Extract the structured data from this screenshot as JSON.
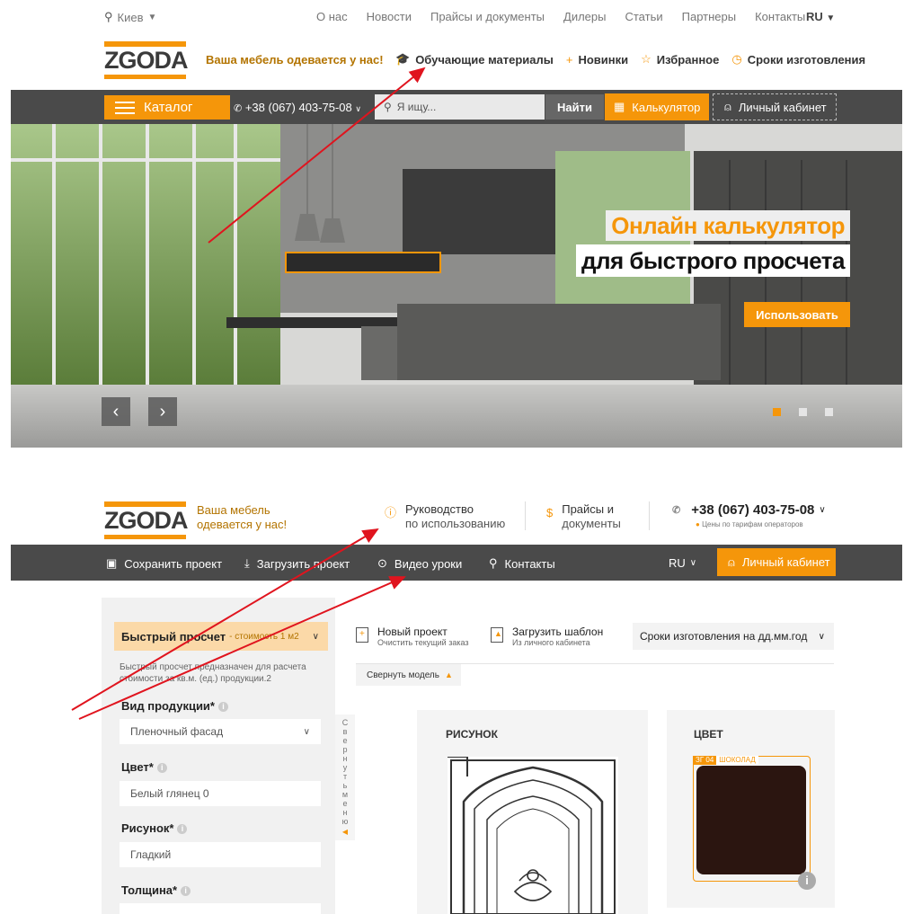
{
  "topbar": {
    "city": "Киев",
    "links": [
      "О нас",
      "Новости",
      "Прайсы и документы",
      "Дилеры",
      "Статьи",
      "Партнеры",
      "Контакты"
    ],
    "lang": "RU"
  },
  "header1": {
    "logo": "ZGODA",
    "tagline": "Ваша мебель одевается у нас!",
    "links": [
      "Обучающие материалы",
      "Новинки",
      "Избранное",
      "Сроки изготовления"
    ]
  },
  "bar1": {
    "catalog": "Каталог",
    "phone": "+38 (067) 403-75-08",
    "search_placeholder": "Я ищу...",
    "find": "Найти",
    "calculator": "Калькулятор",
    "cabinet": "Личный кабинет"
  },
  "hero": {
    "title1": "Онлайн калькулятор",
    "title2": "для быстрого просчета",
    "button": "Использовать"
  },
  "header2": {
    "logo": "ZGODA",
    "tagline_line1": "Ваша мебель",
    "tagline_line2": "одевается у нас!",
    "guide_line1": "Руководство",
    "guide_line2": "по использованию",
    "prices_line1": "Прайсы и",
    "prices_line2": "документы",
    "phone": "+38 (067) 403-75-08",
    "phone_note": "Цены по тарифам операторов"
  },
  "bar2": {
    "save": "Сохранить проект",
    "load": "Загрузить проект",
    "video": "Видео уроки",
    "contacts": "Контакты",
    "lang": "RU",
    "cabinet": "Личный кабинет"
  },
  "leftpanel": {
    "fast_title": "Быстрый просчет",
    "fast_sub": "- стоимость 1 м2",
    "description": "Быстрый просчет предназначен для расчета стоимости за кв.м. (ед.) продукции.2",
    "product_label": "Вид продукции*",
    "product_value": "Пленочный фасад",
    "color_label": "Цвет*",
    "color_value": "Белый глянец 0",
    "pattern_label": "Рисунок*",
    "pattern_value": "Гладкий",
    "thickness_label": "Толщина*",
    "collapse_menu": "Свернуть меню"
  },
  "content": {
    "new_project": "Новый проект",
    "new_project_sub": "Очистить текущий заказ",
    "load_template": "Загрузить шаблон",
    "load_template_sub": "Из личного кабинета",
    "deadline": "Сроки изготовления на дд.мм.год",
    "collapse_model": "Свернуть модель",
    "pattern_card": "РИСУНОК",
    "color_card": "ЦВЕТ",
    "color_code": "ЗГ 04",
    "color_name": "ШОКОЛАД"
  },
  "colors": {
    "accent": "#f5960a",
    "dark_bar": "#4a4a4a",
    "annotation": "#e0141e",
    "swatch": "#2b1510"
  }
}
